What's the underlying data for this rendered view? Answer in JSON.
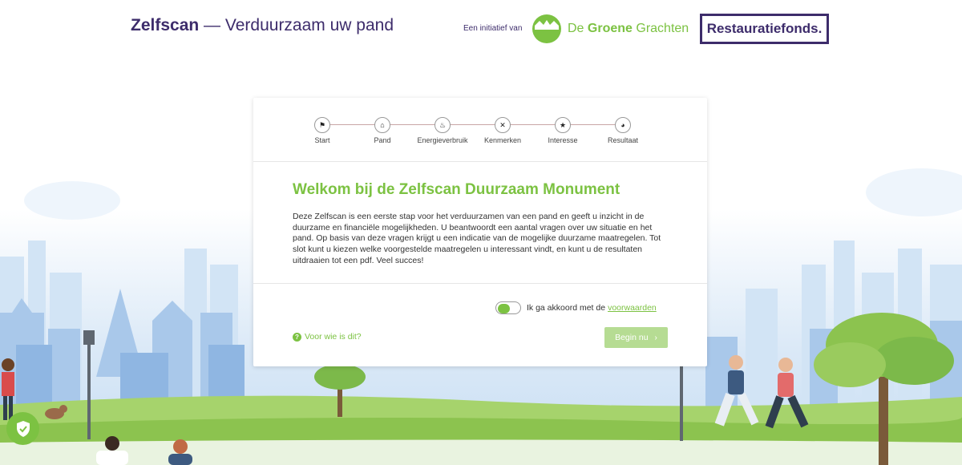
{
  "header": {
    "app_name": "Zelfscan",
    "app_subtitle": "— Verduurzaam uw pand",
    "initiative_label": "Een initiatief van",
    "partner1": {
      "name_part1": "De ",
      "name_bold": "Groene",
      "name_part2": " Grachten",
      "logo_icon": "groene-grachten-logo"
    },
    "partner2": {
      "name": "Restauratiefonds."
    }
  },
  "stepper": {
    "steps": [
      {
        "label": "Start",
        "icon": "⚑"
      },
      {
        "label": "Pand",
        "icon": "⌂"
      },
      {
        "label": "Energieverbruik",
        "icon": "♨"
      },
      {
        "label": "Kenmerken",
        "icon": "✕"
      },
      {
        "label": "Interesse",
        "icon": "★"
      },
      {
        "label": "Resultaat",
        "icon": "◕"
      }
    ]
  },
  "main": {
    "title": "Welkom bij de Zelfscan Duurzaam Monument",
    "intro": "Deze Zelfscan is een eerste stap voor het verduurzamen van een pand en geeft u inzicht in de duurzame en financiële mogelijkheden. U beantwoordt een aantal vragen over uw situatie en het pand. Op basis van deze vragen krijgt u een indicatie van de mogelijke duurzame maatregelen. Tot slot kunt u kiezen welke voorgestelde maatregelen u interessant vindt, en kunt u de resultaten uitdraaien tot een pdf. Veel succes!"
  },
  "footer": {
    "agree_text": "Ik ga akkoord met de",
    "agree_link": "voorwaarden",
    "who_link": "Voor wie is dit?",
    "begin_button": "Begin nu",
    "begin_chevron": "›"
  },
  "colors": {
    "brand_green": "#7cc242",
    "brand_purple": "#3d2c6b",
    "button_disabled": "#b6dc93"
  }
}
